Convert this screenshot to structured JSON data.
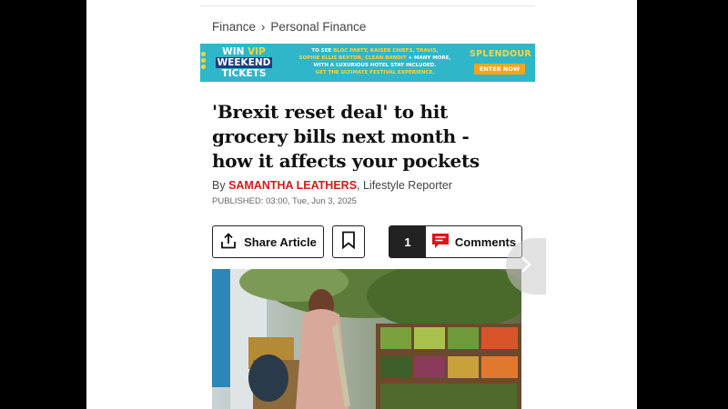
{
  "breadcrumb": {
    "items": [
      "Finance",
      "Personal Finance"
    ]
  },
  "ad": {
    "win_vip_win": "WIN",
    "win_vip_vip": " VIP",
    "win_weekend": "WEEKEND",
    "win_tickets": "TICKETS",
    "line1_prefix": "TO SEE ",
    "line1_acts": "BLOC PARTY, KAISER CHIEFS, TRAVIS,",
    "line2_acts": "SOPHIE ELLIS BEXTOR, CLEAN BANDIT",
    "line2_suffix": " + MANY MORE,",
    "line3": "WITH A LUXURIOUS HOTEL STAY INCLUDED.",
    "line4": "GET THE ULTIMATE FESTIVAL EXPERIENCE.",
    "brand": "SPLENDOUR",
    "cta": "ENTER NOW"
  },
  "article": {
    "headline": "'Brexit reset deal' to hit grocery bills next month - how it affects your pockets",
    "by_prefix": "By ",
    "author": "SAMANTHA LEATHERS",
    "author_role": ", Lifestyle Reporter",
    "published": "PUBLISHED: 03:00, Tue, Jun 3, 2025"
  },
  "actions": {
    "share_label": "Share Article",
    "comment_count": "1",
    "comments_label": "Comments"
  },
  "icons": {
    "share": "share-icon",
    "bookmark": "bookmark-icon",
    "comment": "comment-bubble-icon",
    "next": "chevron-right-icon"
  },
  "colors": {
    "accent_red": "#d41a1a",
    "ad_teal": "#2fb7c9",
    "ad_yellow": "#ffd23c"
  }
}
